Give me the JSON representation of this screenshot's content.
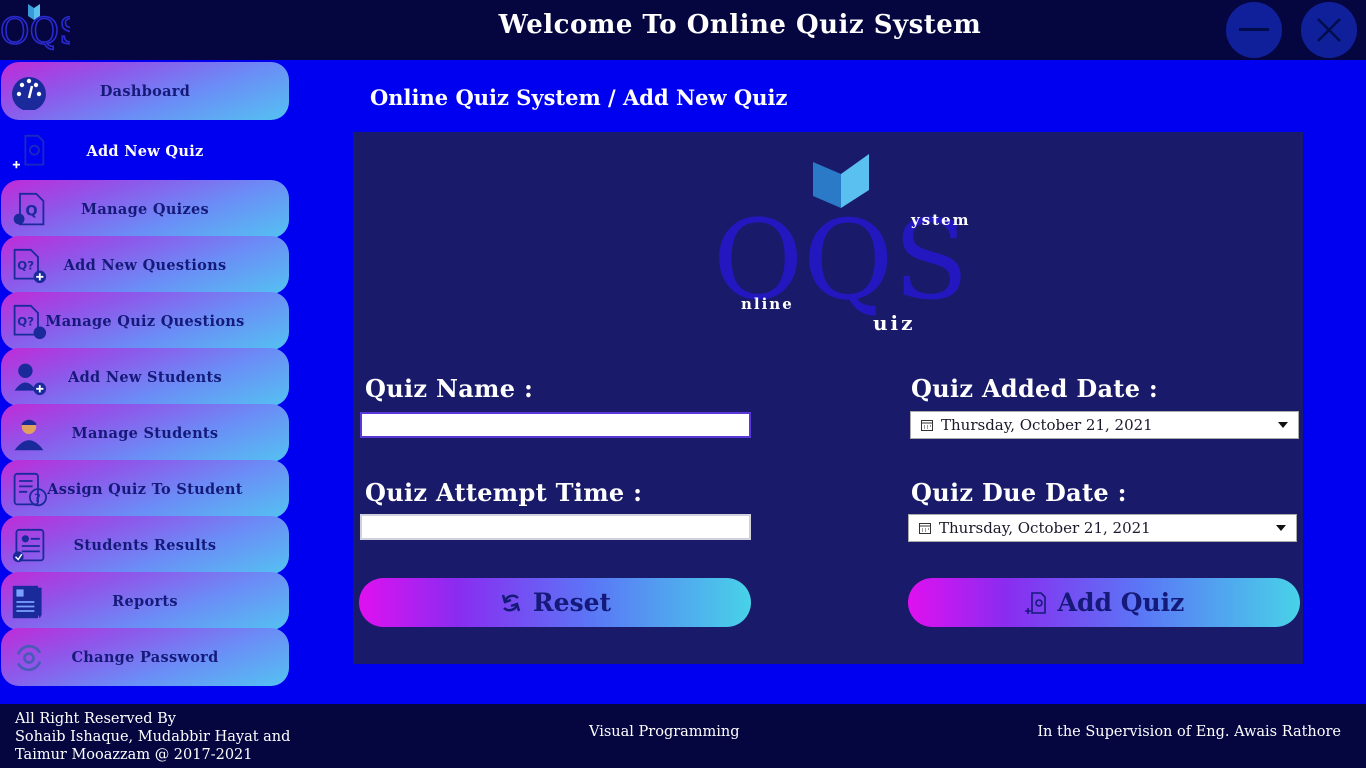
{
  "header": {
    "title": "Welcome To  Online Quiz System",
    "logo_text": "OQS",
    "minimize_icon": "minimize-icon",
    "close_icon": "close-icon"
  },
  "sidebar": {
    "items": [
      {
        "label": "Dashboard",
        "icon": "dashboard-gauge-icon",
        "active": false
      },
      {
        "label": "Add New Quiz",
        "icon": "add-quiz-icon",
        "active": true
      },
      {
        "label": "Manage Quizes",
        "icon": "manage-quiz-icon",
        "active": false
      },
      {
        "label": "Add New Questions",
        "icon": "add-question-icon",
        "active": false
      },
      {
        "label": "Manage Quiz Questions",
        "icon": "manage-questions-icon",
        "active": false
      },
      {
        "label": "Add New Students",
        "icon": "add-student-icon",
        "active": false
      },
      {
        "label": "Manage Students",
        "icon": "student-icon",
        "active": false
      },
      {
        "label": "Assign Quiz To Student",
        "icon": "assign-quiz-icon",
        "active": false
      },
      {
        "label": "Students Results",
        "icon": "results-icon",
        "active": false
      },
      {
        "label": "Reports",
        "icon": "reports-icon",
        "active": false
      },
      {
        "label": "Change Password",
        "icon": "change-password-icon",
        "active": false
      }
    ]
  },
  "main": {
    "breadcrumb": "Online Quiz System / Add New Quiz",
    "logo": {
      "big_letters": "OQS",
      "word_online": "nline",
      "word_quiz": "uiz",
      "word_system": "ystem"
    },
    "form": {
      "quiz_name_label": "Quiz Name :",
      "quiz_name_value": "",
      "attempt_time_label": "Quiz Attempt Time :",
      "attempt_time_value": "",
      "added_date_label": "Quiz Added Date :",
      "added_date_value": "Thursday, October 21, 2021",
      "due_date_label": "Quiz Due Date :",
      "due_date_value": "Thursday, October 21, 2021"
    },
    "buttons": {
      "reset": "Reset",
      "add_quiz": "Add Quiz"
    }
  },
  "footer": {
    "rights_line1": "All Right Reserved By",
    "rights_line2": "Sohaib Ishaque, Mudabbir Hayat and",
    "rights_line3": "Taimur Mooazzam @ 2017-2021",
    "course": "Visual Programming",
    "supervision": "In the Supervision of Eng. Awais Rathore"
  },
  "colors": {
    "background": "#0000f0",
    "header": "#050640",
    "panel": "#1a1a6a",
    "nav_text": "#151a7a"
  }
}
